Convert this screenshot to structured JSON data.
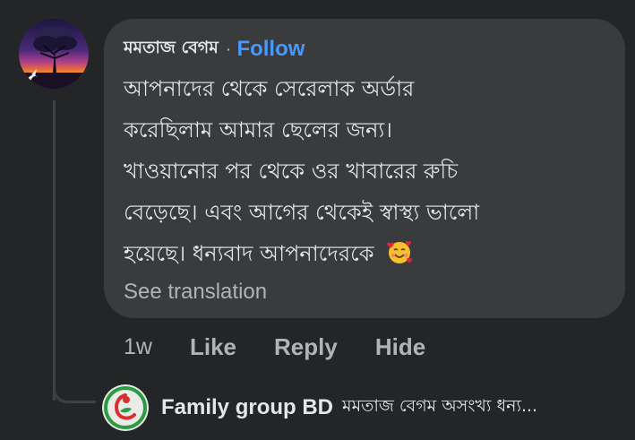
{
  "comment": {
    "author": "মমতাজ বেগম",
    "separator": "·",
    "follow_label": "Follow",
    "text_lines": [
      "আপনাদের থেকে সেরেলাক অর্ডার",
      "করেছিলাম আমার ছেলের জন্য।",
      "খাওয়ানোর পর থেকে ওর খাবারের রুচি",
      "বেড়েছে। এবং আগের থেকেই স্বাস্থ্য ভালো",
      "হয়েছে। ধন্যবাদ আপনাদেরকে"
    ],
    "emoji_icon": "smiling-face-with-hearts-icon",
    "see_translation": "See translation",
    "time": "1w",
    "like_label": "Like",
    "reply_label": "Reply",
    "hide_label": "Hide"
  },
  "reply": {
    "author": "Family group BD",
    "snippet": "মমতাজ বেগম অসংখ্য ধন্য..."
  },
  "colors": {
    "background": "#242526",
    "bubble": "#3a3b3c",
    "link": "#4599ff",
    "secondary_text": "#b0b3b8",
    "primary_text": "#e4e6eb"
  }
}
